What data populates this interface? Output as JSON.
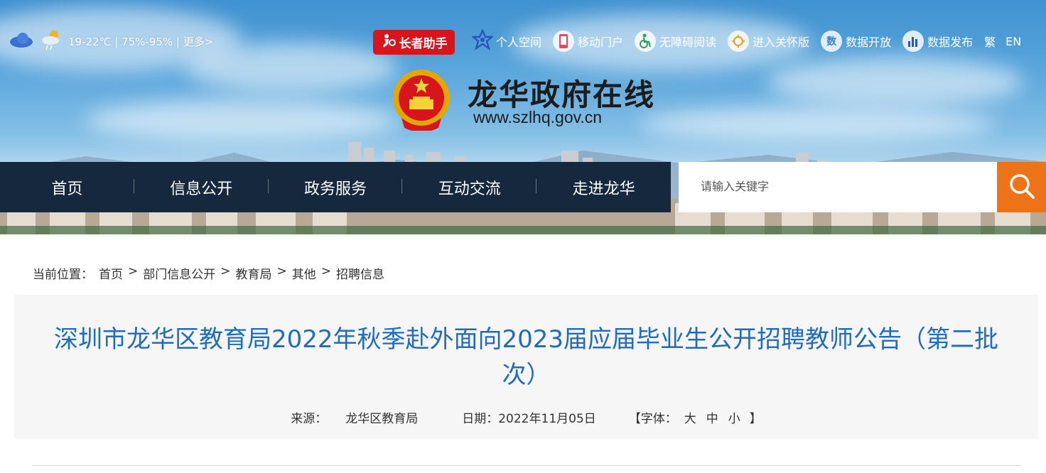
{
  "weather": {
    "text": "19-22℃ | 75%-95% | 更多>"
  },
  "elder_helper": {
    "label": "长者助手"
  },
  "toolbar": {
    "personal_space": "个人空间",
    "mobile_portal": "移动门户",
    "accessible_reading": "无障碍阅读",
    "care_version": "进入关怀版",
    "data_open": "数据开放",
    "data_release": "数据发布",
    "traditional": "繁",
    "english": "EN"
  },
  "site": {
    "title": "龙华政府在线",
    "url": "www.szlhq.gov.cn"
  },
  "nav": {
    "items": [
      {
        "label": "首页"
      },
      {
        "label": "信息公开"
      },
      {
        "label": "政务服务"
      },
      {
        "label": "互动交流"
      },
      {
        "label": "走进龙华"
      }
    ]
  },
  "search": {
    "placeholder": "请输入关键字"
  },
  "breadcrumb": {
    "prefix": "当前位置：",
    "items": [
      "首页",
      "部门信息公开",
      "教育局",
      "其他",
      "招聘信息"
    ],
    "separator": ">"
  },
  "article": {
    "title": "深圳市龙华区教育局2022年秋季赴外面向2023届应届毕业生公开招聘教师公告（第二批次）",
    "source_label": "来源：",
    "source": "龙华区教育局",
    "date_label": "日期：",
    "date": "2022年11月05日",
    "font_label": "【字体：",
    "font_large": "大",
    "font_medium": "中",
    "font_small": "小",
    "font_close": "】"
  },
  "colors": {
    "nav_bg": "#15283e",
    "search_button": "#ee7318",
    "title": "#1f6bbf",
    "elder_button": "#d9141c"
  }
}
